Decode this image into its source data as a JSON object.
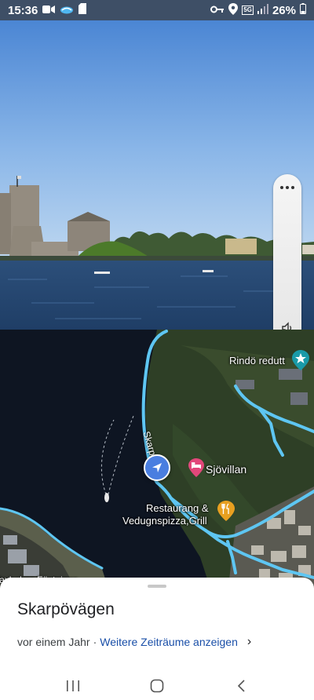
{
  "status_bar": {
    "time": "15:36",
    "battery": "26%",
    "network": "5G",
    "icons": [
      "video-camera-icon",
      "cloud-icon",
      "sim-card-icon",
      "key-icon",
      "location-icon",
      "signal-icon",
      "battery-icon"
    ]
  },
  "street_view": {
    "controls": {
      "more_icon": "more-dots-icon",
      "sound_icon": "speaker-icon"
    }
  },
  "map": {
    "road_name": "Skarpövägen",
    "road_label_partial": "Skarp...gen",
    "places": [
      {
        "name": "Rindö redutt",
        "icon": "landmark-icon",
        "color": "#1a9aa8"
      },
      {
        "name": "Sjövillan",
        "icon": "hotel-icon",
        "color": "#e2477a"
      },
      {
        "name": "Restaurang & Vedugnspizza,Grill",
        "line1": "Restaurang &",
        "line2": "Vedugnspizza,Grill",
        "icon": "restaurant-icon",
        "color": "#e8a020"
      }
    ],
    "bottom_left_label": "Vaxholms Fästnings..."
  },
  "sheet": {
    "title": "Skarpövägen",
    "time_ago": "vor einem Jahr",
    "separator": "·",
    "more_link": "Weitere Zeiträume anzeigen",
    "chevron": "›"
  },
  "nav": {
    "recent": "recent-apps-icon",
    "home": "home-icon",
    "back": "back-icon"
  }
}
